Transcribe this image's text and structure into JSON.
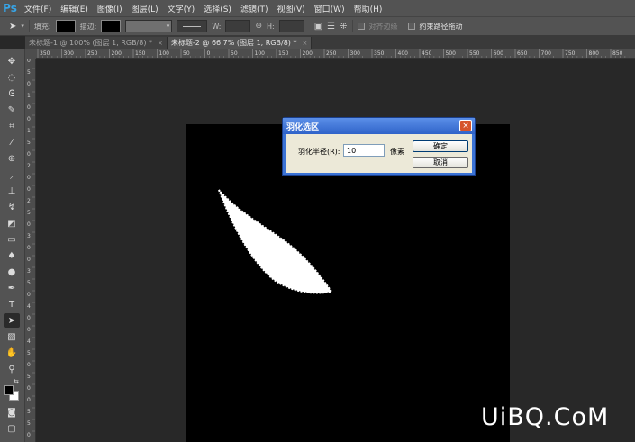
{
  "app": {
    "logo": "Ps"
  },
  "menu": [
    "文件(F)",
    "编辑(E)",
    "图像(I)",
    "图层(L)",
    "文字(Y)",
    "选择(S)",
    "滤镜(T)",
    "视图(V)",
    "窗口(W)",
    "帮助(H)"
  ],
  "options": {
    "fill_label": "填充:",
    "stroke_label": "描边:",
    "w_label": "W:",
    "h_label": "H:",
    "align_edges": "对齐边缘",
    "constrain_path": "约束路径拖动"
  },
  "tabs": [
    {
      "label": "未标题-1 @ 100% (图层 1, RGB/8) *",
      "close": "×",
      "active": false
    },
    {
      "label": "未标题-2 @ 66.7% (图层 1, RGB/8) *",
      "close": "×",
      "active": true
    }
  ],
  "ruler_h": [
    "350",
    "300",
    "250",
    "200",
    "150",
    "100",
    "50",
    "0",
    "50",
    "100",
    "150",
    "200",
    "250",
    "300",
    "350",
    "400",
    "450",
    "500",
    "550",
    "600",
    "650",
    "700",
    "750",
    "800",
    "850"
  ],
  "ruler_v": [
    "0",
    "5",
    "0",
    "1",
    "0",
    "0",
    "1",
    "5",
    "0",
    "2",
    "0",
    "0",
    "2",
    "5",
    "0",
    "3",
    "0",
    "0",
    "3",
    "5",
    "0",
    "4",
    "0",
    "0",
    "4",
    "5",
    "0",
    "5",
    "0",
    "0",
    "5",
    "5",
    "0"
  ],
  "dialog": {
    "title": "羽化选区",
    "close": "×",
    "radius_label": "羽化半径(R):",
    "radius_value": "10",
    "unit": "像素",
    "ok": "确定",
    "cancel": "取消"
  },
  "watermark": "UiBQ.CoM"
}
